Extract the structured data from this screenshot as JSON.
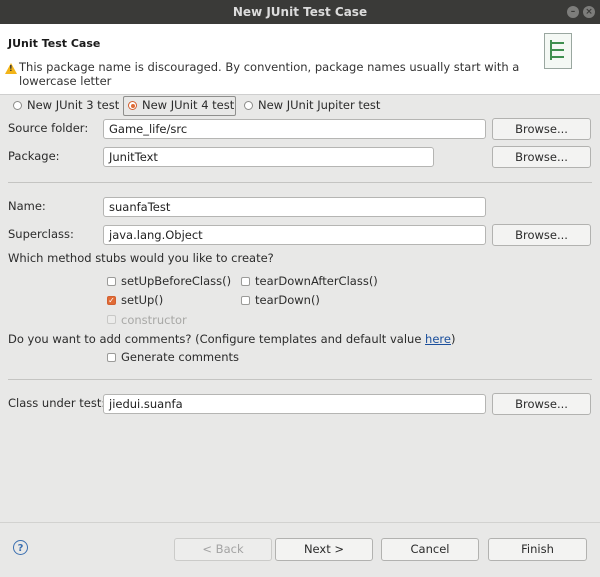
{
  "window": {
    "title": "New JUnit Test Case"
  },
  "header": {
    "title": "JUnit Test Case",
    "message": "This package name is discouraged. By convention, package names usually start with a lowercase letter"
  },
  "version": {
    "options": [
      "New JUnit 3 test",
      "New JUnit 4 test",
      "New JUnit Jupiter test"
    ],
    "selected": "New JUnit 4 test"
  },
  "source_folder": {
    "label": "Source folder:",
    "value": "Game_life/src",
    "browse": "Browse..."
  },
  "package": {
    "label": "Package:",
    "value": "JunitText",
    "browse": "Browse..."
  },
  "name": {
    "label": "Name:",
    "value": "suanfaTest"
  },
  "superclass": {
    "label": "Superclass:",
    "value": "java.lang.Object",
    "browse": "Browse..."
  },
  "stubs": {
    "question": "Which method stubs would you like to create?",
    "setUpBeforeClass": {
      "label": "setUpBeforeClass()",
      "checked": false
    },
    "tearDownAfterClass": {
      "label": "tearDownAfterClass()",
      "checked": false
    },
    "setUp": {
      "label": "setUp()",
      "checked": true
    },
    "tearDown": {
      "label": "tearDown()",
      "checked": false
    },
    "constructor": {
      "label": "constructor",
      "checked": false,
      "enabled": false
    }
  },
  "comments": {
    "question_prefix": "Do you want to add comments? (Configure templates and default value ",
    "link": "here",
    "question_suffix": ")",
    "generate": {
      "label": "Generate comments",
      "checked": false
    }
  },
  "class_under_test": {
    "label": "Class under test:",
    "value": "jiedui.suanfa",
    "browse": "Browse..."
  },
  "footer": {
    "help": "?",
    "back": "< Back",
    "next": "Next >",
    "cancel": "Cancel",
    "finish": "Finish"
  },
  "colors": {
    "accent": "#e06b36",
    "titlebar": "#3a3a38",
    "link": "#1b4f9c",
    "warning": "#f2b418"
  }
}
